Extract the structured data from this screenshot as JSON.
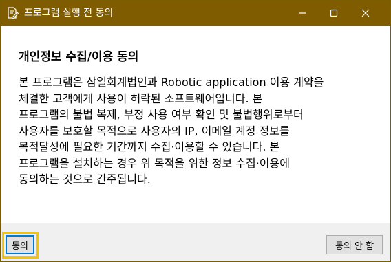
{
  "window": {
    "title": "프로그램 실행 전 동의",
    "icons": {
      "app": "document-pen-icon",
      "minimize": "minimize-icon",
      "maximize": "maximize-icon",
      "close": "close-icon"
    }
  },
  "content": {
    "heading": "개인정보 수집/이용 동의",
    "lines": [
      "본 프로그램은 삼일회계법인과 Robotic application 이용 계약을",
      "체결한 고객에게 사용이 허락된 소프트웨어입니다. 본",
      "프로그램의 불법 복제, 부정 사용 여부 확인 및 불법행위로부터",
      "사용자를 보호할 목적으로 사용자의 IP, 이메일 계정 정보를",
      "목적달성에 필요한 기간까지 수집·이용할 수 있습니다. 본",
      "프로그램을 설치하는 경우 위 목적을 위한 정보 수집·이용에",
      "동의하는 것으로 간주됩니다."
    ]
  },
  "footer": {
    "agree_label": "동의",
    "disagree_label": "동의 안 함"
  },
  "colors": {
    "titlebar": "#805c00",
    "highlight": "#f5c400",
    "footer_bg": "#f0f0f0"
  }
}
